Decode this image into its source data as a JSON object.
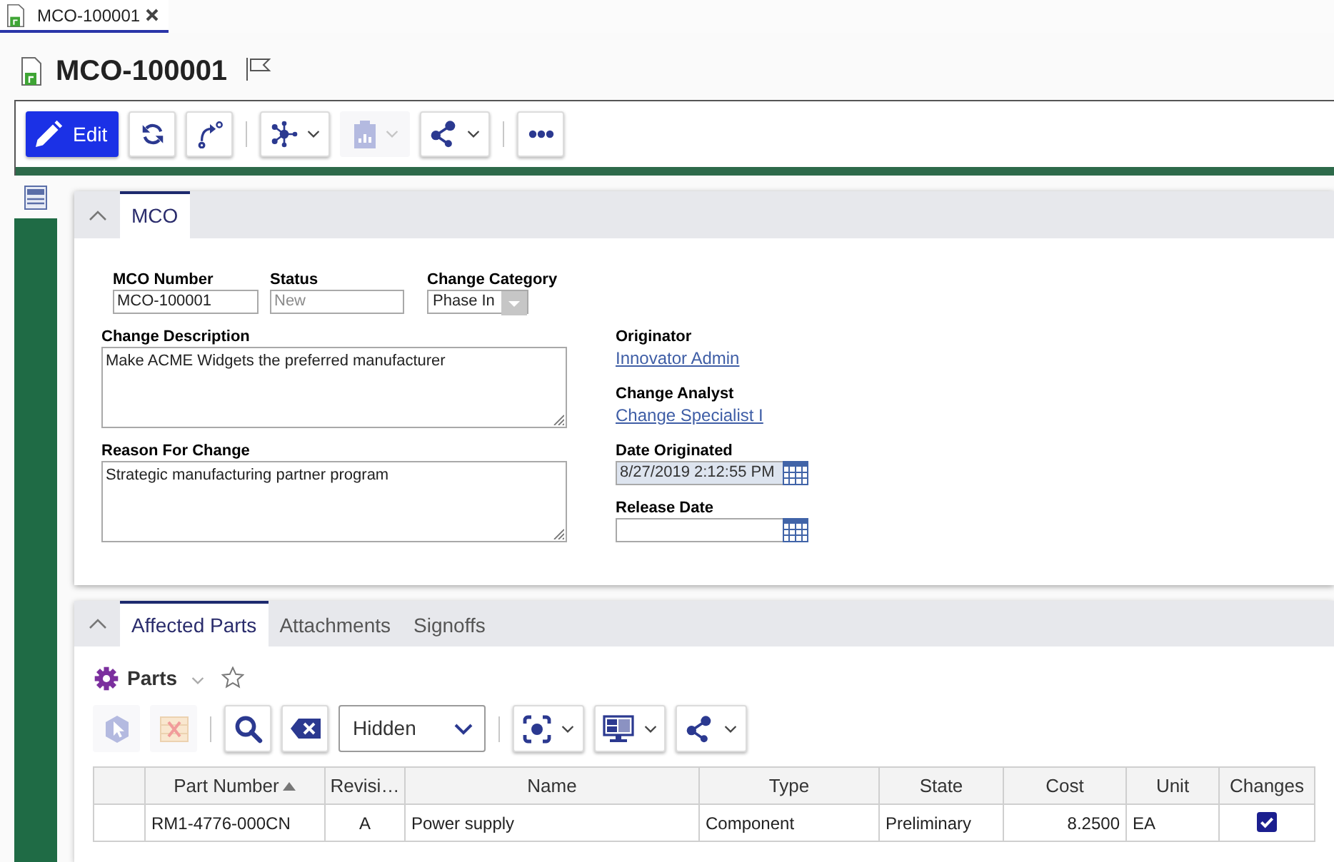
{
  "document_tabs": [
    {
      "label": "MCO-100001",
      "selected": true
    }
  ],
  "title": "MCO-100001",
  "toolbar": [
    {
      "kind": "primary",
      "label": "Edit",
      "disabled": false
    },
    {
      "kind": "icon",
      "disabled": false
    },
    {
      "kind": "icon",
      "disabled": false
    },
    {
      "kind": "separator"
    },
    {
      "kind": "dropdown",
      "disabled": false
    },
    {
      "kind": "dropdown",
      "disabled": true
    },
    {
      "kind": "dropdown",
      "disabled": false
    },
    {
      "kind": "separator"
    },
    {
      "kind": "icon",
      "disabled": false
    }
  ],
  "mco_panel": {
    "expanded": true,
    "tabs": [
      {
        "label": "MCO",
        "selected": true
      }
    ],
    "top_fields": [
      {
        "label": "MCO Number",
        "kind": "text",
        "value": "MCO-100001",
        "disabled": false
      },
      {
        "label": "Status",
        "kind": "text",
        "value": "New",
        "disabled": true
      },
      {
        "label": "Change Category",
        "kind": "select",
        "value": "Phase In",
        "disabled": false
      }
    ],
    "left_fields": [
      {
        "label": "Change Description",
        "kind": "textarea",
        "value": "Make ACME Widgets the preferred manufacturer",
        "disabled": false
      },
      {
        "label": "Reason For Change",
        "kind": "textarea",
        "value": "Strategic manufacturing partner program",
        "disabled": false
      }
    ],
    "right_fields": [
      {
        "label": "Originator",
        "kind": "link",
        "value": "Innovator Admin",
        "disabled": false
      },
      {
        "label": "Change Analyst",
        "kind": "link",
        "value": "Change Specialist I",
        "disabled": false
      },
      {
        "label": "Date Originated",
        "kind": "date",
        "value": "8/27/2019 2:12:55 PM",
        "disabled": true
      },
      {
        "label": "Release Date",
        "kind": "date",
        "disabled": false
      }
    ]
  },
  "parts_panel": {
    "expanded": true,
    "tabs": [
      {
        "label": "Affected Parts",
        "selected": true
      },
      {
        "label": "Attachments",
        "selected": false
      },
      {
        "label": "Signoffs",
        "selected": false
      }
    ],
    "grid_title": "Parts",
    "toolbar": [
      {
        "kind": "icon",
        "disabled": true
      },
      {
        "kind": "icon",
        "disabled": true
      },
      {
        "kind": "separator"
      },
      {
        "kind": "icon",
        "disabled": false
      },
      {
        "kind": "icon",
        "disabled": false
      },
      {
        "kind": "select",
        "value": "Hidden"
      },
      {
        "kind": "separator"
      },
      {
        "kind": "dropdown",
        "disabled": false
      },
      {
        "kind": "dropdown",
        "disabled": false
      },
      {
        "kind": "dropdown",
        "disabled": false
      }
    ],
    "table": {
      "columns": [
        {
          "label": "Part Number",
          "sorted": true
        },
        {
          "label": "Revisi…",
          "sorted": false
        },
        {
          "label": "Name",
          "sorted": false
        },
        {
          "label": "Type",
          "sorted": false
        },
        {
          "label": "State",
          "sorted": false
        },
        {
          "label": "Cost",
          "sorted": false
        },
        {
          "label": "Unit",
          "sorted": false
        },
        {
          "label": "Changes",
          "sorted": false
        }
      ],
      "rows": [
        {
          "cells": [
            "RM1-4776-000CN",
            "A",
            "Power supply",
            "Component",
            "Preliminary",
            "8.2500",
            "EA"
          ],
          "changes": true
        }
      ]
    }
  }
}
